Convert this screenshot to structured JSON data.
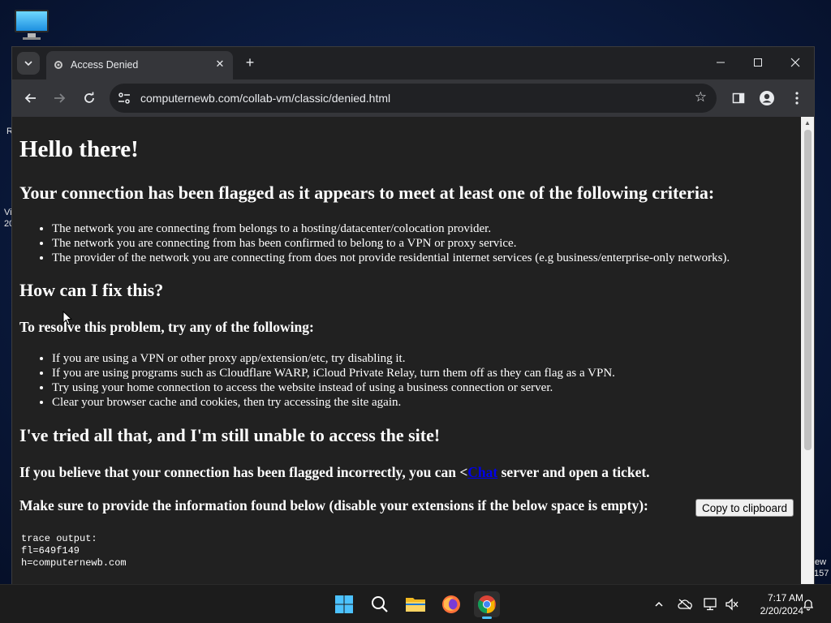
{
  "desktop": {
    "edge_texts": {
      "left1": "R",
      "left2": "Vi",
      "left3": "20",
      "right1": "ew",
      "right2": "157"
    }
  },
  "browser": {
    "tab": {
      "title": "Access Denied"
    },
    "omnibox": {
      "url": "computernewb.com/collab-vm/classic/denied.html"
    }
  },
  "page": {
    "h1": "Hello there!",
    "h2_criteria": "Your connection has been flagged as it appears to meet at least one of the following criteria:",
    "criteria": [
      "The network you are connecting from belongs to a hosting/datacenter/colocation provider.",
      "The network you are connecting from has been confirmed to belong to a VPN or proxy service.",
      "The provider of the network you are connecting from does not provide residential internet services (e.g business/enterprise-only networks)."
    ],
    "h2_fix": "How can I fix this?",
    "h3_resolve": "To resolve this problem, try any of the following:",
    "fixes": [
      "If you are using a VPN or other proxy app/extension/etc, try disabling it.",
      "If you are using programs such as Cloudflare WARP, iCloud Private Relay, turn them off as they can flag as a VPN.",
      "Try using your home connection to access the website instead of using a business connection or server.",
      "Clear your browser cache and cookies, then try accessing the site again."
    ],
    "h2_tried": "I've tried all that, and I'm still unable to access the site!",
    "ticket_prefix": "If you believe that your connection has been flagged incorrectly, you can <",
    "ticket_link": "Chat",
    "ticket_suffix": " server and open a ticket.",
    "provide_info": "Make sure to provide the information found below (disable your extensions if the below space is empty):",
    "copy_button": "Copy to clipboard",
    "trace_lines": [
      "trace output:",
      "",
      "fl=649f149",
      "h=computernewb.com"
    ]
  },
  "taskbar": {
    "time": "7:17 AM",
    "date": "2/20/2024"
  },
  "colors": {
    "page_bg": "#212121",
    "link": "#0000ee",
    "accent": "#4cc2ff"
  }
}
